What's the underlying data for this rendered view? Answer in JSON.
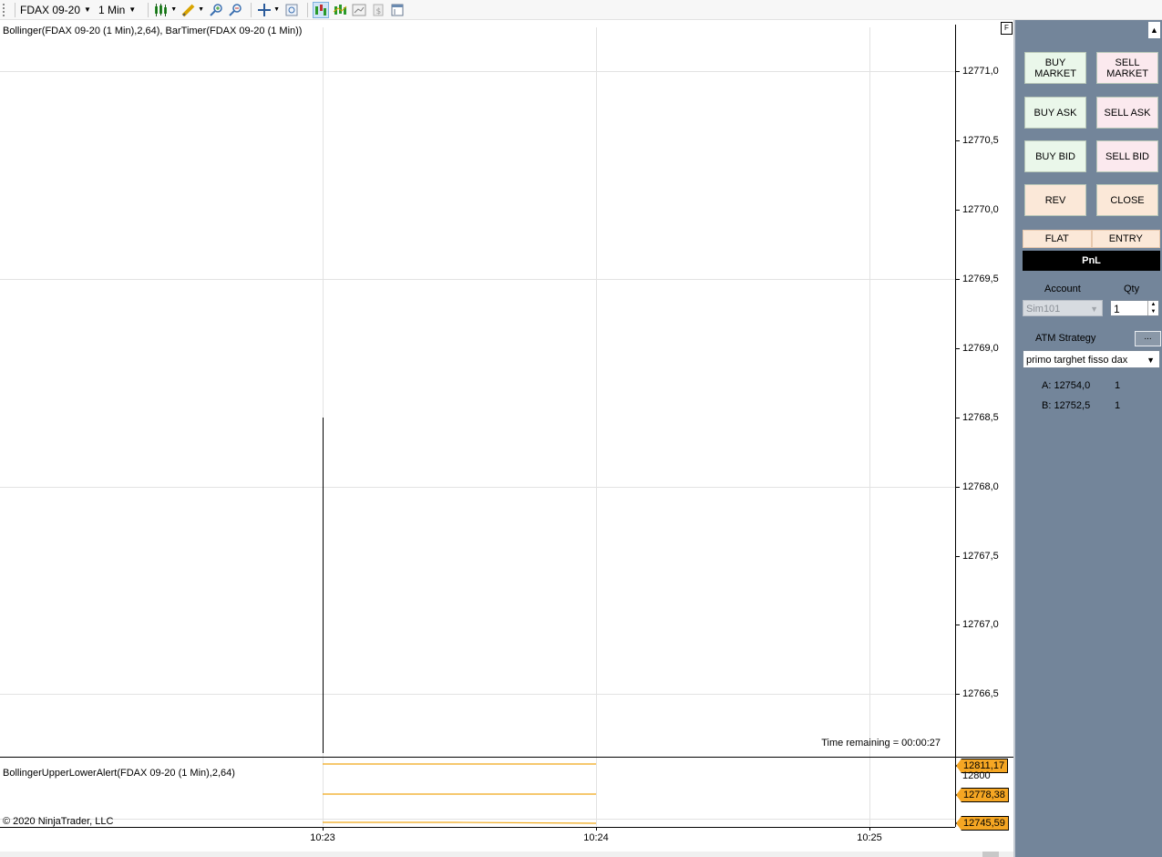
{
  "toolbar": {
    "instrument": "FDAX 09-20",
    "interval": "1 Min"
  },
  "chart": {
    "indicator_title": "Bollinger(FDAX 09-20 (1 Min),2,64), BarTimer(FDAX 09-20 (1 Min))",
    "price_labels": [
      "12771,0",
      "12770,5",
      "12770,0",
      "12769,5",
      "12769,0",
      "12768,5",
      "12768,0",
      "12767,5",
      "12767,0",
      "12766,5"
    ],
    "time_remaining": "Time remaining = 00:00:27",
    "f_button": "F",
    "subpanel_title": "BollingerUpperLowerAlert(FDAX 09-20 (1 Min),2,64)",
    "subpanel_axis_label": "12800",
    "subpanel_tags": [
      "12811,17",
      "12778,38",
      "12745,59"
    ],
    "copyright": "© 2020 NinjaTrader, LLC",
    "time_labels": [
      "10:23",
      "10:24",
      "10:25"
    ],
    "line_color": "#f0a818"
  },
  "order_panel": {
    "buy_market": "BUY MARKET",
    "sell_market": "SELL MARKET",
    "buy_ask": "BUY ASK",
    "sell_ask": "SELL ASK",
    "buy_bid": "BUY BID",
    "sell_bid": "SELL BID",
    "rev": "REV",
    "close": "CLOSE",
    "position": "FLAT",
    "entry": "ENTRY",
    "pnl": "PnL",
    "account_label": "Account",
    "account_value": "Sim101",
    "qty_label": "Qty",
    "qty_value": "1",
    "atm_label": "ATM Strategy",
    "atm_button": "...",
    "atm_value": "primo targhet fisso dax",
    "ask_line": "A: 12754,0",
    "ask_qty": "1",
    "bid_line": "B: 12752,5",
    "bid_qty": "1",
    "panel_color": "#73859a"
  }
}
